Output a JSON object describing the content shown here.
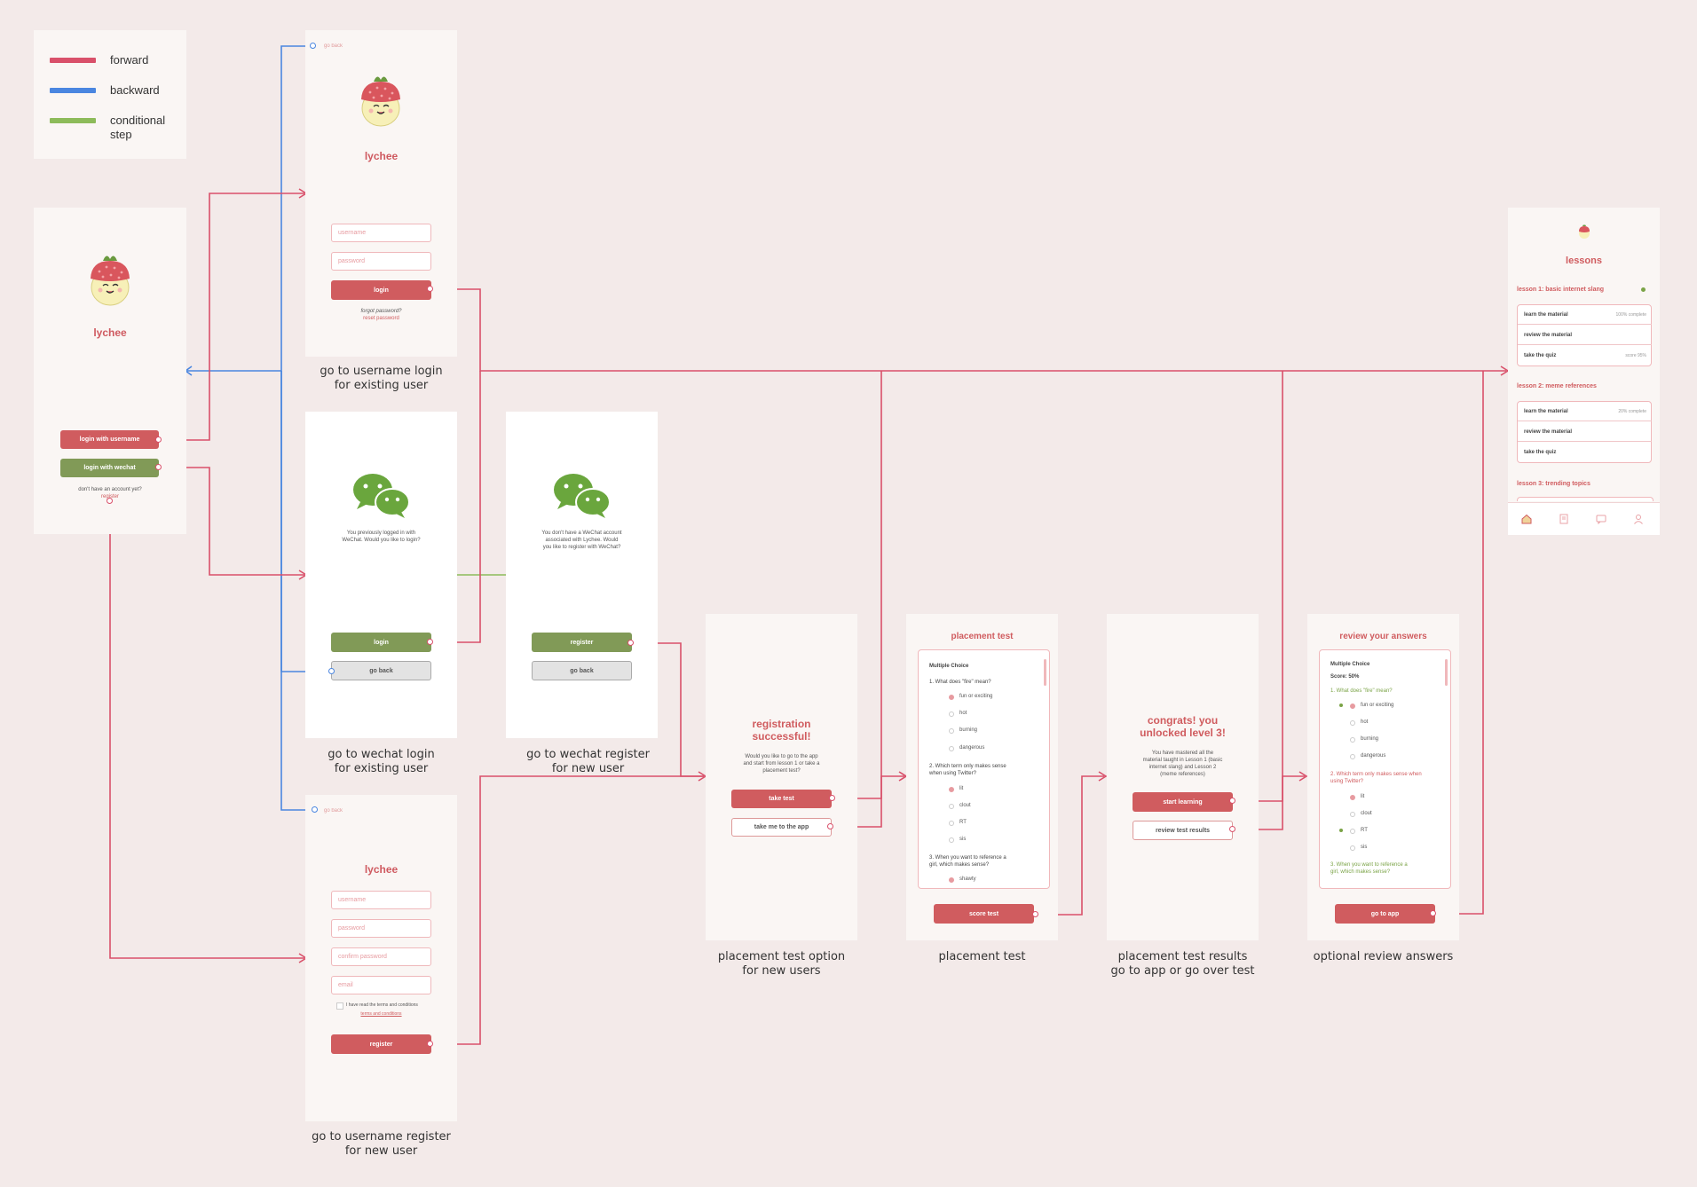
{
  "legend": {
    "items": [
      {
        "label": "forward",
        "color": "#d9506a"
      },
      {
        "label": "backward",
        "color": "#4a86e0"
      },
      {
        "label": "conditional\nstep",
        "color": "#8dbb5a"
      }
    ]
  },
  "colors": {
    "forward": "#d9506a",
    "backward": "#4a86e0",
    "conditional": "#8dbb5a",
    "brand": "#d05c5f",
    "wechat_green": "#819a57"
  },
  "welcome": {
    "brand": "lychee",
    "login_username": "login with username",
    "login_wechat": "login with wechat",
    "no_account": "don't have an account yet?",
    "register_link": "register"
  },
  "username_login": {
    "go_back": "go back",
    "brand": "lychee",
    "username_placeholder": "username",
    "password_placeholder": "password",
    "login": "login",
    "forgot": "forgot password?",
    "reset": "reset password",
    "caption": "go to username login\nfor existing user"
  },
  "wechat_login": {
    "message": "You previously logged in with\nWeChat. Would you like to login?",
    "login": "login",
    "go_back": "go back",
    "caption": "go to wechat login\nfor existing user"
  },
  "wechat_register": {
    "message": "You don't have a WeChat account\nassociated with Lychee. Would\nyou like to register with WeChat?",
    "register": "register",
    "go_back": "go back",
    "caption": "go to wechat register\nfor new user"
  },
  "username_register": {
    "go_back": "go back",
    "brand": "lychee",
    "username_placeholder": "username",
    "password_placeholder": "password",
    "confirm_placeholder": "confirm password",
    "email_placeholder": "email",
    "terms_text": "I have read the terms and conditions",
    "terms_link": "terms and conditions",
    "register": "register",
    "caption": "go to username register\nfor new user"
  },
  "registration_success": {
    "title": "registration\nsuccessful!",
    "message": "Would you like to go to the app\nand start from lesson 1 or take a\nplacement test?",
    "take_test": "take test",
    "take_me": "take me to the app",
    "caption": "placement test option\nfor new users"
  },
  "placement_test": {
    "title": "placement test",
    "section": "Multiple Choice",
    "q1": "1. What does \"fire\" mean?",
    "q1_options": [
      "fun or exciting",
      "hot",
      "burning",
      "dangerous"
    ],
    "q2": "2. Which term only makes sense\nwhen using Twitter?",
    "q2_options": [
      "lit",
      "clout",
      "RT",
      "sis"
    ],
    "q3": "3. When you want to reference a\ngirl, which makes sense?",
    "q3_options": [
      "shawty"
    ],
    "score": "score test",
    "caption": "placement test"
  },
  "test_results": {
    "title": "congrats! you\nunlocked level 3!",
    "message": "You have mastered all the\nmaterial taught in Lesson 1 (basic\ninternet slang) and Lesson 2\n(meme references)",
    "start": "start learning",
    "review": "review test results",
    "caption": "placement test results\ngo to app or go over test"
  },
  "review_answers": {
    "title": "review your answers",
    "section": "Multiple Choice",
    "score": "Score: 50%",
    "q1": "1. What does \"fire\" mean?",
    "q1_options": [
      "fun or exciting",
      "hot",
      "burning",
      "dangerous"
    ],
    "q2": "2. Which term only makes sense when\nusing Twitter?",
    "q2_options": [
      "lit",
      "clout",
      "RT",
      "sis"
    ],
    "q3": "3. When you want to reference a\ngirl, which makes sense?",
    "go_app": "go to app",
    "caption": "optional review answers"
  },
  "lessons": {
    "title": "lessons",
    "lesson1": "lesson 1: basic internet slang",
    "lesson1_rows": [
      {
        "label": "learn the material",
        "status": "100% complete"
      },
      {
        "label": "review the material",
        "status": ""
      },
      {
        "label": "take the quiz",
        "status": "score 95%"
      }
    ],
    "lesson2": "lesson 2: meme references",
    "lesson2_rows": [
      {
        "label": "learn the material",
        "status": "20% complete"
      },
      {
        "label": "review the material",
        "status": ""
      },
      {
        "label": "take the quiz",
        "status": ""
      }
    ],
    "lesson3": "lesson 3: trending topics"
  }
}
